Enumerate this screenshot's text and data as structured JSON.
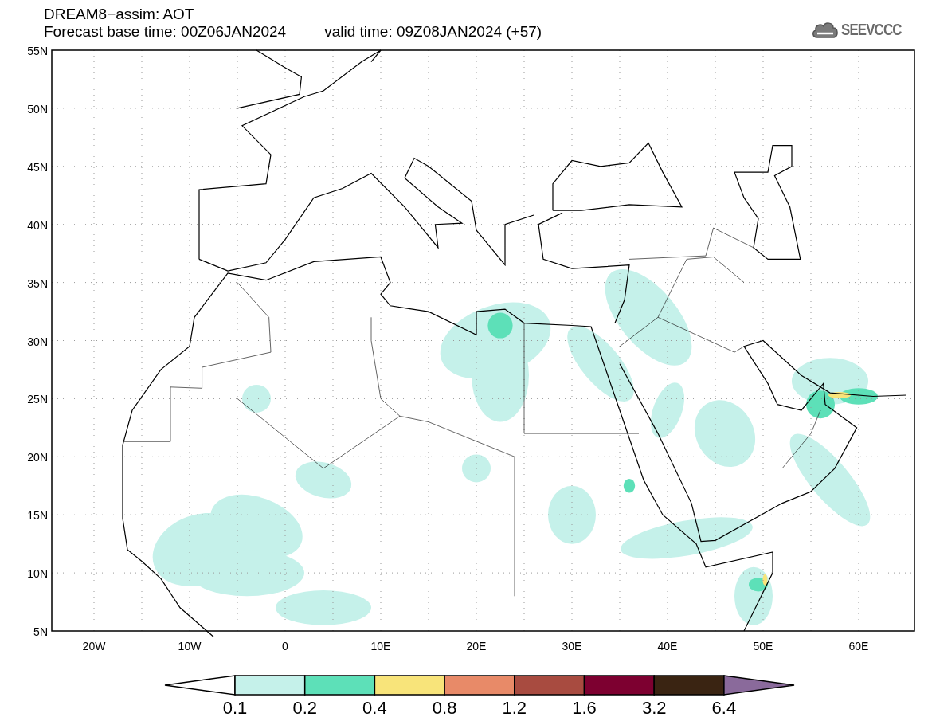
{
  "header": {
    "title": "DREAM8−assim: AOT",
    "base_time": "Forecast base time: 00Z06JAN2024",
    "valid_time": "valid time: 09Z08JAN2024 (+57)"
  },
  "logo": {
    "text": "SEEVCCC"
  },
  "map": {
    "lat_labels": [
      "55N",
      "50N",
      "45N",
      "40N",
      "35N",
      "30N",
      "25N",
      "20N",
      "15N",
      "10N",
      "5N"
    ],
    "lon_labels": [
      "20W",
      "10W",
      "0",
      "10E",
      "20E",
      "30E",
      "40E",
      "50E",
      "60E"
    ]
  },
  "legend": {
    "bins": [
      {
        "kind": "arrow-left",
        "color": "#ffffff"
      },
      {
        "kind": "box",
        "color": "#c5f1ea"
      },
      {
        "kind": "box",
        "color": "#5de0b8"
      },
      {
        "kind": "box",
        "color": "#f8e47a"
      },
      {
        "kind": "box",
        "color": "#e88a68"
      },
      {
        "kind": "box",
        "color": "#a84b40"
      },
      {
        "kind": "box",
        "color": "#7d0030"
      },
      {
        "kind": "box",
        "color": "#3a2412"
      },
      {
        "kind": "arrow-right",
        "color": "#8a6a9b"
      }
    ],
    "labels": [
      "0.1",
      "0.2",
      "0.4",
      "0.8",
      "1.2",
      "1.6",
      "3.2",
      "6.4"
    ]
  }
}
